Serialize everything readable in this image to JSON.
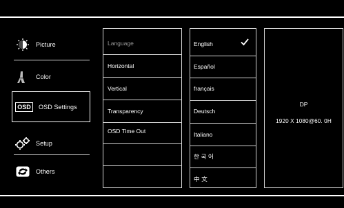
{
  "menu": {
    "items": [
      {
        "label": "Picture",
        "icon": "picture-icon"
      },
      {
        "label": "Color",
        "icon": "color-icon"
      },
      {
        "label": "OSD Settings",
        "icon": "osd-icon",
        "selected": true
      },
      {
        "label": "Setup",
        "icon": "setup-gears-icon"
      },
      {
        "label": "Others",
        "icon": "others-icon"
      }
    ],
    "osd_icon_text": "OSD"
  },
  "settings": {
    "items": [
      "Language",
      "Horizontal",
      "Vertical",
      "Transparency",
      "OSD Time Out"
    ]
  },
  "languages": {
    "items": [
      "English",
      "Español",
      "français",
      "Deutsch",
      "Italiano",
      "한 국 어",
      "中 文"
    ],
    "selected": "English"
  },
  "info": {
    "input": "DP",
    "resolution": "1920 X 1080@60. 0H"
  }
}
